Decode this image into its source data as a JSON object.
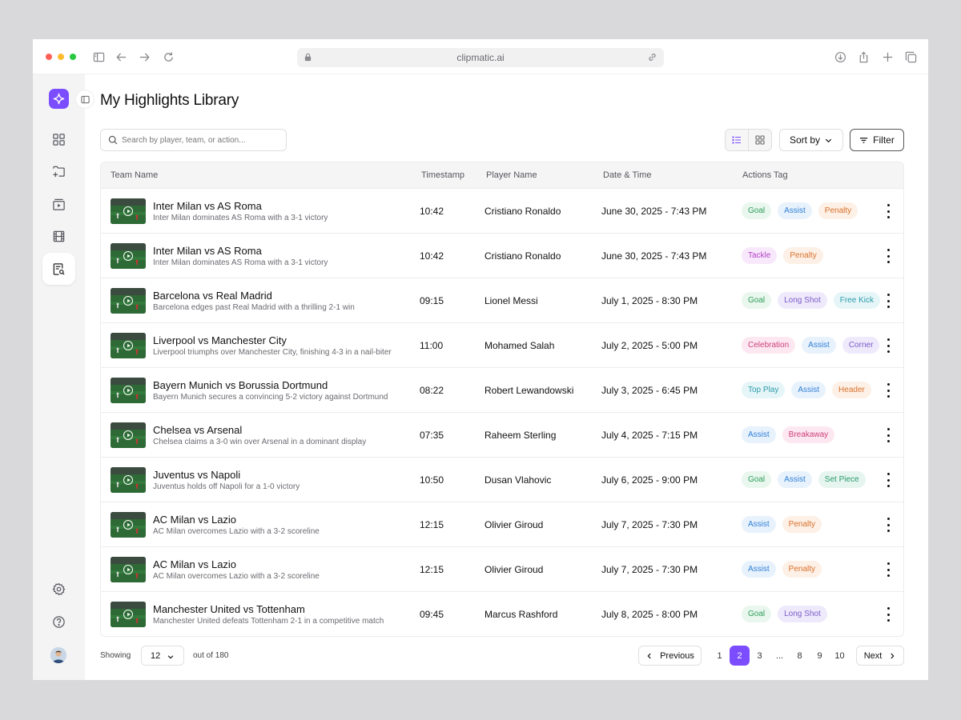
{
  "browser": {
    "url": "clipmatic.ai",
    "traffic_lights": [
      "#ff5f57",
      "#febc2e",
      "#28c840"
    ]
  },
  "colors": {
    "accent": "#7c4dff",
    "tags": {
      "Goal": {
        "bg": "#e9f7ee",
        "fg": "#2f9e5a"
      },
      "Assist": {
        "bg": "#e8f2fc",
        "fg": "#2f7fd6"
      },
      "Penalty": {
        "bg": "#fdf0e6",
        "fg": "#d9712b"
      },
      "Tackle": {
        "bg": "#f8e8fb",
        "fg": "#b13fc7"
      },
      "Long Shot": {
        "bg": "#efeafb",
        "fg": "#7a5bc9"
      },
      "Free Kick": {
        "bg": "#e6f6f8",
        "fg": "#2b9aab"
      },
      "Celebration": {
        "bg": "#fde8f1",
        "fg": "#cc3f7b"
      },
      "Corner": {
        "bg": "#efeafb",
        "fg": "#7a5bc9"
      },
      "Top Play": {
        "bg": "#e6f6f8",
        "fg": "#2b9aab"
      },
      "Header": {
        "bg": "#fdf0e6",
        "fg": "#d9712b"
      },
      "Breakaway": {
        "bg": "#fde8f1",
        "fg": "#cc3f7b"
      },
      "Set Piece": {
        "bg": "#e6f5ef",
        "fg": "#2b9a6e"
      }
    }
  },
  "sidebar": {
    "items": [
      {
        "name": "dashboard-grid-icon",
        "active": false
      },
      {
        "name": "folder-add-icon",
        "active": false
      },
      {
        "name": "video-library-icon",
        "active": false
      },
      {
        "name": "film-icon",
        "active": false
      },
      {
        "name": "document-search-icon",
        "active": true
      }
    ],
    "bottom": [
      {
        "name": "settings-icon"
      },
      {
        "name": "help-icon"
      }
    ]
  },
  "page": {
    "title": "My Highlights Library",
    "search_placeholder": "Search by player, team, or action...",
    "sort_label": "Sort by",
    "filter_label": "Filter"
  },
  "table": {
    "columns": [
      "Team Name",
      "Timestamp",
      "Player Name",
      "Date & Time",
      "Actions Tag"
    ],
    "rows": [
      {
        "title": "Inter Milan vs AS Roma",
        "subtitle": "Inter Milan dominates AS Roma with a 3-1 victory",
        "timestamp": "10:42",
        "player": "Cristiano Ronaldo",
        "datetime": "June 30, 2025 - 7:43 PM",
        "tags": [
          "Goal",
          "Assist",
          "Penalty"
        ]
      },
      {
        "title": "Inter Milan vs AS Roma",
        "subtitle": "Inter Milan dominates AS Roma with a 3-1 victory",
        "timestamp": "10:42",
        "player": "Cristiano Ronaldo",
        "datetime": "June 30, 2025 - 7:43 PM",
        "tags": [
          "Tackle",
          "Penalty"
        ]
      },
      {
        "title": "Barcelona vs Real Madrid",
        "subtitle": "Barcelona edges past Real Madrid with a thrilling 2-1 win",
        "timestamp": "09:15",
        "player": "Lionel Messi",
        "datetime": "July 1, 2025 - 8:30 PM",
        "tags": [
          "Goal",
          "Long Shot",
          "Free Kick"
        ]
      },
      {
        "title": "Liverpool vs Manchester City",
        "subtitle": "Liverpool triumphs over Manchester City, finishing 4-3 in a nail-biter",
        "timestamp": "11:00",
        "player": "Mohamed Salah",
        "datetime": "July 2, 2025 - 5:00 PM",
        "tags": [
          "Celebration",
          "Assist",
          "Corner"
        ]
      },
      {
        "title": "Bayern Munich vs Borussia Dortmund",
        "subtitle": "Bayern Munich secures a convincing 5-2 victory against Dortmund",
        "timestamp": "08:22",
        "player": "Robert Lewandowski",
        "datetime": "July 3, 2025 - 6:45 PM",
        "tags": [
          "Top Play",
          "Assist",
          "Header"
        ]
      },
      {
        "title": "Chelsea vs Arsenal",
        "subtitle": "Chelsea claims a 3-0 win over Arsenal in a dominant display",
        "timestamp": "07:35",
        "player": "Raheem Sterling",
        "datetime": "July 4, 2025 - 7:15 PM",
        "tags": [
          "Assist",
          "Breakaway"
        ]
      },
      {
        "title": "Juventus vs Napoli",
        "subtitle": "Juventus holds off Napoli for a 1-0 victory",
        "timestamp": "10:50",
        "player": "Dusan Vlahovic",
        "datetime": "July 6, 2025 - 9:00 PM",
        "tags": [
          "Goal",
          "Assist",
          "Set Piece"
        ]
      },
      {
        "title": "AC Milan vs Lazio",
        "subtitle": "AC Milan overcomes Lazio with a 3-2 scoreline",
        "timestamp": "12:15",
        "player": "Olivier Giroud",
        "datetime": "July 7, 2025 - 7:30 PM",
        "tags": [
          "Assist",
          "Penalty"
        ]
      },
      {
        "title": "AC Milan vs Lazio",
        "subtitle": "AC Milan overcomes Lazio with a 3-2 scoreline",
        "timestamp": "12:15",
        "player": "Olivier Giroud",
        "datetime": "July 7, 2025 - 7:30 PM",
        "tags": [
          "Assist",
          "Penalty"
        ]
      },
      {
        "title": "Manchester United vs Tottenham",
        "subtitle": "Manchester United defeats Tottenham 2-1 in a competitive match",
        "timestamp": "09:45",
        "player": "Marcus Rashford",
        "datetime": "July 8, 2025 - 8:00 PM",
        "tags": [
          "Goal",
          "Long Shot"
        ]
      }
    ]
  },
  "pagination": {
    "showing_label": "Showing",
    "page_size": "12",
    "out_of": "out of 180",
    "previous": "Previous",
    "next": "Next",
    "pages": [
      "1",
      "2",
      "3",
      "...",
      "8",
      "9",
      "10"
    ],
    "current": "2"
  }
}
